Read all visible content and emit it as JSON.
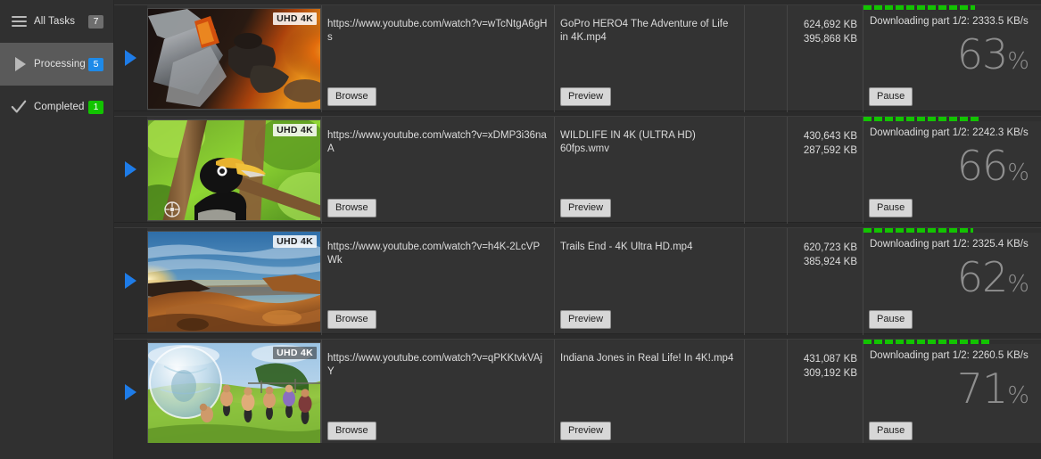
{
  "sidebar": {
    "items": [
      {
        "label": "All Tasks",
        "count": "7",
        "icon": "hamburger-icon",
        "badge_color": "#6e6e6e",
        "active": false
      },
      {
        "label": "Processing",
        "count": "5",
        "icon": "play-icon",
        "badge_color": "#1e8ae8",
        "active": true
      },
      {
        "label": "Completed",
        "count": "1",
        "icon": "check-icon",
        "badge_color": "#12c400",
        "active": false
      }
    ]
  },
  "labels": {
    "browse": "Browse",
    "preview": "Preview",
    "pause": "Pause",
    "uhd_badge": "UHD 4K",
    "percent_sign": "%"
  },
  "colors": {
    "accent_blue": "#1e7ce8",
    "progress_green": "#12c400",
    "badge_grey": "#6e6e6e",
    "panel_bg": "#333333",
    "app_bg": "#2b2b2b",
    "sidebar_bg": "#303030",
    "sidebar_active": "#5a5a5a"
  },
  "tasks": [
    {
      "thumb": "lava-suit",
      "url": "https://www.youtube.com/watch?v=wTcNtgA6gHs",
      "title": "GoPro HERO4  The Adventure of Life in 4K.mp4",
      "size_total": "624,692 KB",
      "size_done": "395,868 KB",
      "status": "Downloading part 1/2: 2333.5 KB/s",
      "percent": "63",
      "progress_value": 63
    },
    {
      "thumb": "hornbill",
      "url": "https://www.youtube.com/watch?v=xDMP3i36naA",
      "title": "WILDLIFE IN 4K (ULTRA HD) 60fps.wmv",
      "size_total": "430,643 KB",
      "size_done": "287,592 KB",
      "status": "Downloading part 1/2: 2242.3 KB/s",
      "percent": "66",
      "progress_value": 66
    },
    {
      "thumb": "canyon-sunset",
      "url": "https://www.youtube.com/watch?v=h4K-2LcVPWk",
      "title": "Trails End  - 4K Ultra HD.mp4",
      "size_total": "620,723 KB",
      "size_done": "385,924 KB",
      "status": "Downloading part 1/2: 2325.4 KB/s",
      "percent": "62",
      "progress_value": 62
    },
    {
      "thumb": "zorb-run",
      "url": "https://www.youtube.com/watch?v=qPKKtvkVAjY",
      "title": "Indiana Jones in Real Life! In 4K!.mp4",
      "size_total": "431,087 KB",
      "size_done": "309,192 KB",
      "status": "Downloading part 1/2: 2260.5 KB/s",
      "percent": "71",
      "progress_value": 71
    }
  ]
}
